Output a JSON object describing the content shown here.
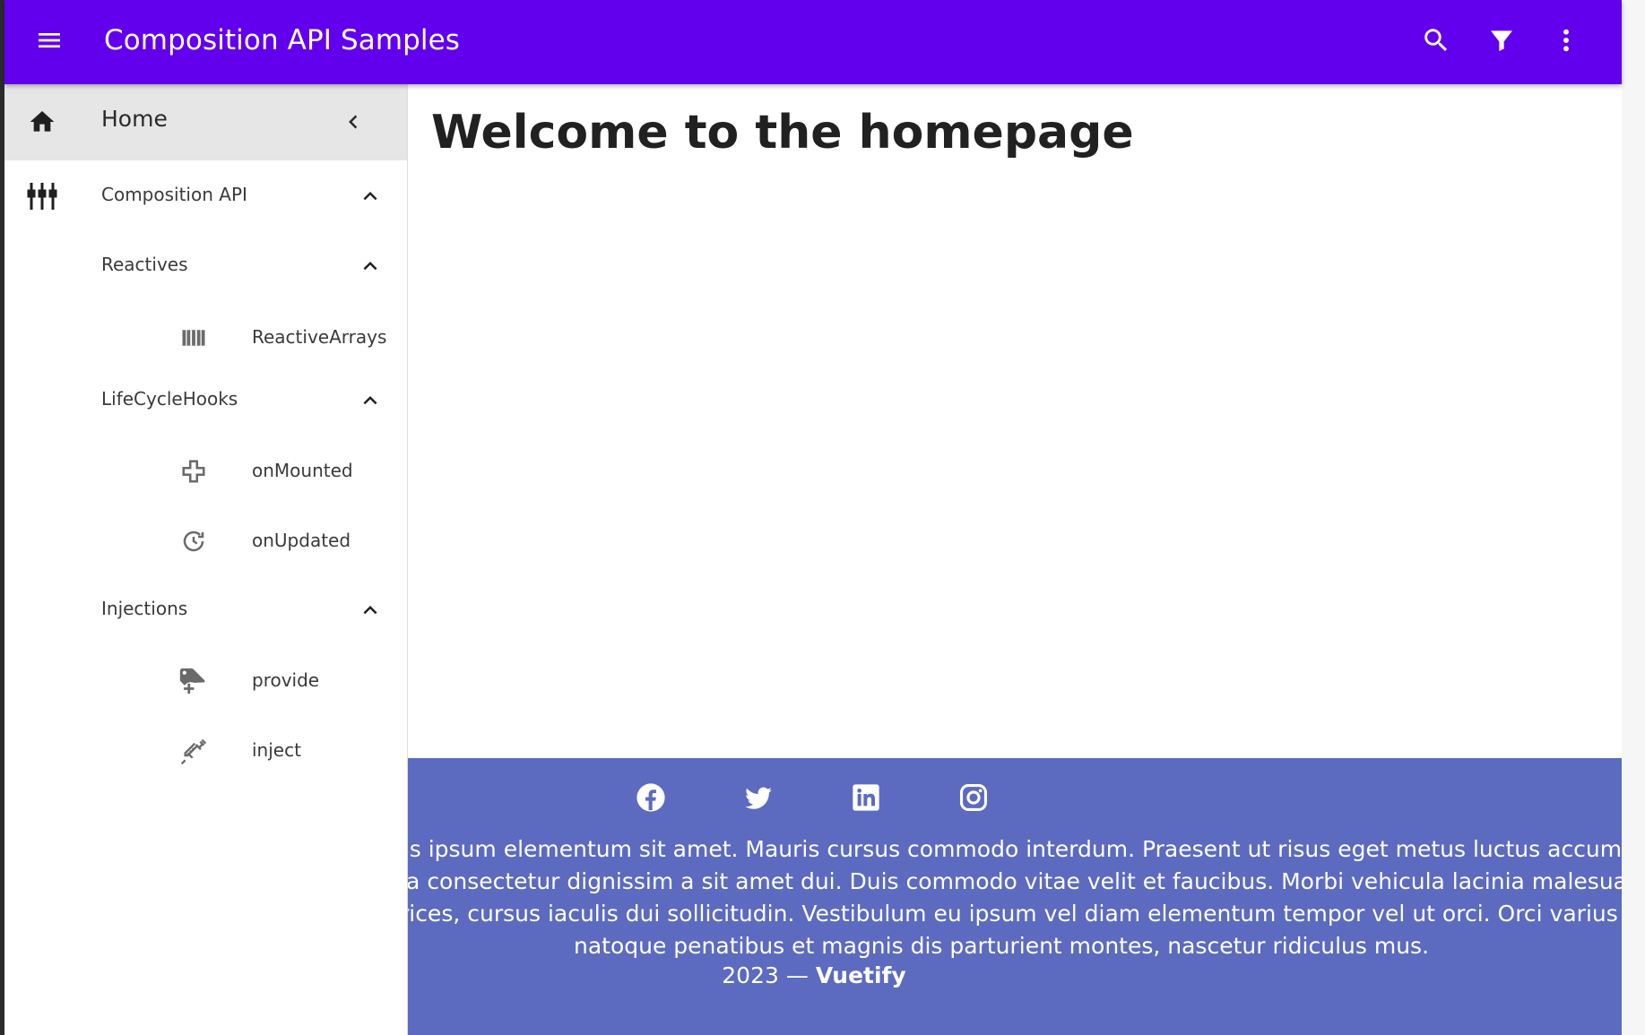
{
  "app_bar": {
    "title": "Composition API Samples",
    "icons": [
      "menu-icon",
      "search-icon",
      "filter-icon",
      "more-vert-icon"
    ],
    "color": "#6200ee"
  },
  "drawer": {
    "home": {
      "label": "Home",
      "icon": "home-icon",
      "collapse_icon": "chevron-left-icon"
    },
    "groups": [
      {
        "label": "Composition API",
        "icon": "tune-icon",
        "expanded": true
      }
    ],
    "subgroups": [
      {
        "label": "Reactives",
        "items": [
          {
            "label": "ReactiveArrays",
            "icon": "view-array-icon"
          }
        ]
      },
      {
        "label": "LifeCycleHooks",
        "items": [
          {
            "label": "onMounted",
            "icon": "plus-outline-icon"
          },
          {
            "label": "onUpdated",
            "icon": "update-icon"
          }
        ]
      },
      {
        "label": "Injections",
        "items": [
          {
            "label": "provide",
            "icon": "tag-plus-icon"
          },
          {
            "label": "inject",
            "icon": "needle-icon"
          }
        ]
      }
    ]
  },
  "main": {
    "title": "Welcome to the homepage"
  },
  "footer": {
    "color": "#5c6bc0",
    "social_icons": [
      "facebook-icon",
      "twitter-icon",
      "linkedin-icon",
      "instagram-icon"
    ],
    "lines": [
      "ulis ipsum elementum sit amet. Mauris cursus commodo interdum. Praesent ut risus eget metus luctus accumsan",
      "ssa consectetur dignissim a sit amet dui. Duis commodo vitae velit et faucibus. Morbi vehicula lacinia malesuada.",
      "ltrices, cursus iaculis dui sollicitudin. Vestibulum eu ipsum vel diam elementum tempor vel ut orci. Orci varius",
      " natoque penatibus et magnis dis parturient montes, nascetur ridiculus mus."
    ],
    "copyright_year": "2023 —",
    "copyright_brand": "Vuetify"
  }
}
